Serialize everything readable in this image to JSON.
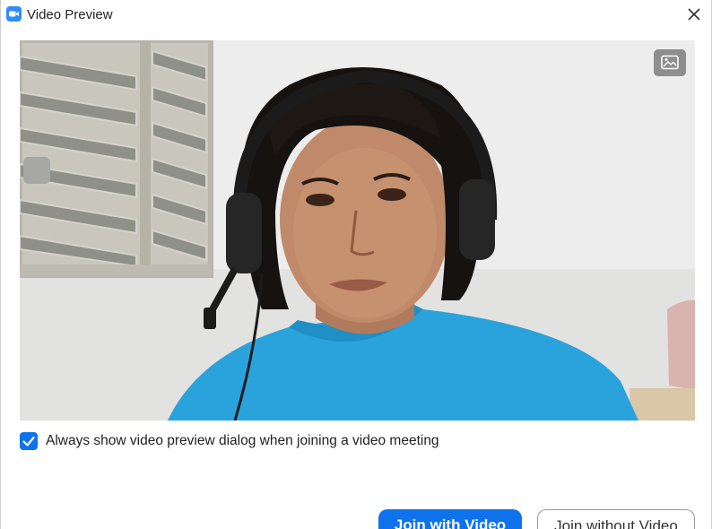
{
  "window": {
    "title": "Video Preview",
    "app_icon": "zoom-camera-icon",
    "close_icon": "close-icon"
  },
  "preview": {
    "background_button_icon": "image-icon"
  },
  "options": {
    "always_show_label": "Always show video preview dialog when joining a video meeting",
    "always_show_checked": true
  },
  "actions": {
    "join_with_video_label": "Join with Video",
    "join_without_video_label": "Join without Video"
  },
  "colors": {
    "accent": "#0e72ed",
    "zoom_blue": "#2d8cff"
  }
}
